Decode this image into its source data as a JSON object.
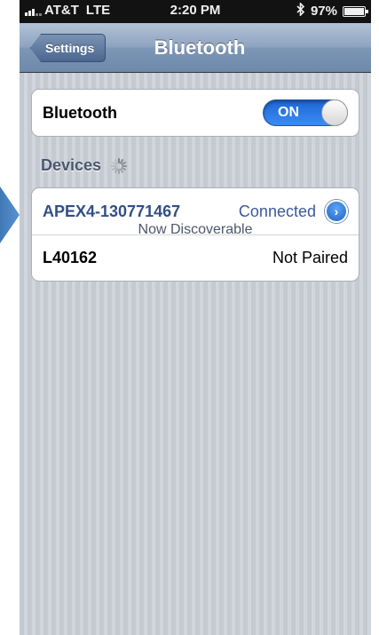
{
  "status_bar": {
    "carrier": "AT&T",
    "network": "LTE",
    "time": "2:20 PM",
    "bluetooth_icon": "bluetooth-icon",
    "battery_percent": "97%",
    "battery_level": 0.97
  },
  "nav": {
    "back_label": "Settings",
    "title": "Bluetooth"
  },
  "bluetooth_row": {
    "label": "Bluetooth",
    "toggle_label": "ON",
    "toggle_on": true,
    "accent": "#2c78e4"
  },
  "devices_header": "Devices",
  "devices": [
    {
      "name": "APEX4-130771467",
      "status": "Connected",
      "detail_icon": "chevron-right-circle-icon"
    },
    {
      "name": "L40162",
      "status": "Not Paired"
    }
  ],
  "footer": "Now Discoverable"
}
